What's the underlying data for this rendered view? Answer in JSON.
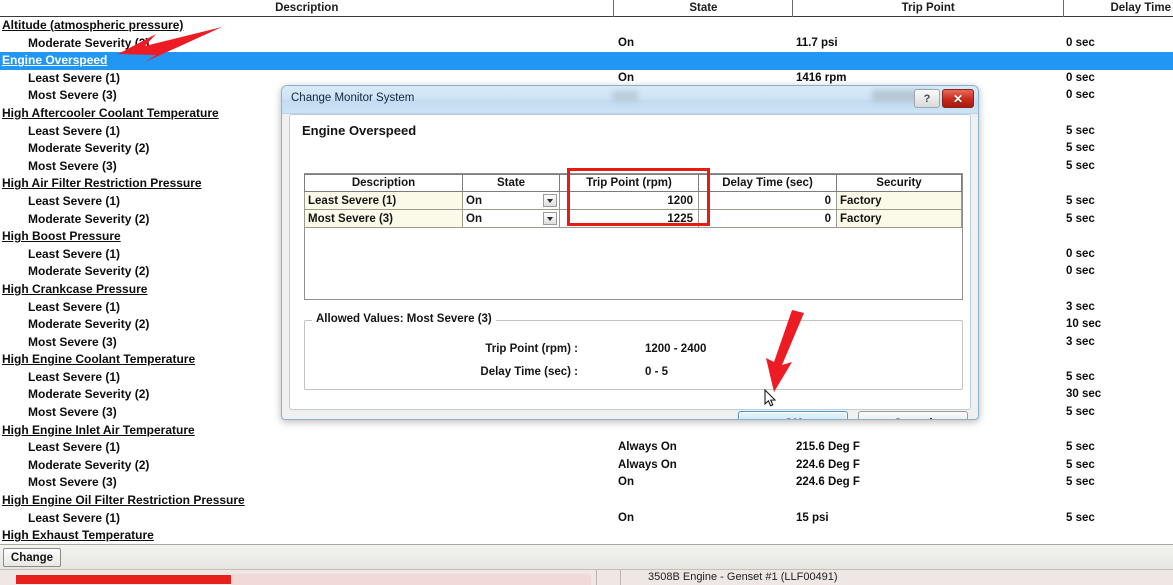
{
  "grid": {
    "columns": [
      "Description",
      "State",
      "Trip Point",
      "Delay Time"
    ],
    "rows": [
      {
        "type": "group",
        "description": "Altitude (atmospheric pressure)",
        "state": "",
        "trip_point": "",
        "delay_time": ""
      },
      {
        "type": "child",
        "description": "Moderate Severity (2)",
        "state": "On",
        "trip_point": "11.7 psi",
        "delay_time": "0 sec"
      },
      {
        "type": "group",
        "description": "Engine Overspeed",
        "state": "",
        "trip_point": "",
        "delay_time": "",
        "selected": true
      },
      {
        "type": "child",
        "description": "Least Severe (1)",
        "state": "On",
        "trip_point": "1416 rpm",
        "delay_time": "0 sec"
      },
      {
        "type": "child",
        "description": "Most Severe (3)",
        "state": "",
        "trip_point": "",
        "delay_time": "0 sec"
      },
      {
        "type": "group",
        "description": "High Aftercooler Coolant Temperature",
        "state": "",
        "trip_point": "",
        "delay_time": ""
      },
      {
        "type": "child",
        "description": "Least Severe (1)",
        "state": "",
        "trip_point": "",
        "delay_time": "5 sec"
      },
      {
        "type": "child",
        "description": "Moderate Severity (2)",
        "state": "",
        "trip_point": "",
        "delay_time": "5 sec"
      },
      {
        "type": "child",
        "description": "Most Severe (3)",
        "state": "",
        "trip_point": "",
        "delay_time": "5 sec"
      },
      {
        "type": "group",
        "description": "High Air Filter Restriction Pressure",
        "state": "",
        "trip_point": "",
        "delay_time": ""
      },
      {
        "type": "child",
        "description": "Least Severe (1)",
        "state": "",
        "trip_point": "",
        "delay_time": "5 sec"
      },
      {
        "type": "child",
        "description": "Moderate Severity (2)",
        "state": "",
        "trip_point": "",
        "delay_time": "5 sec"
      },
      {
        "type": "group",
        "description": "High Boost Pressure",
        "state": "",
        "trip_point": "",
        "delay_time": ""
      },
      {
        "type": "child",
        "description": "Least Severe (1)",
        "state": "",
        "trip_point": "",
        "delay_time": "0 sec"
      },
      {
        "type": "child",
        "description": "Moderate Severity (2)",
        "state": "",
        "trip_point": "",
        "delay_time": "0 sec"
      },
      {
        "type": "group",
        "description": "High Crankcase Pressure",
        "state": "",
        "trip_point": "",
        "delay_time": ""
      },
      {
        "type": "child",
        "description": "Least Severe (1)",
        "state": "",
        "trip_point": "",
        "delay_time": "3 sec"
      },
      {
        "type": "child",
        "description": "Moderate Severity (2)",
        "state": "",
        "trip_point": "",
        "delay_time": "10 sec"
      },
      {
        "type": "child",
        "description": "Most Severe (3)",
        "state": "",
        "trip_point": "",
        "delay_time": "3 sec"
      },
      {
        "type": "group",
        "description": "High Engine Coolant Temperature",
        "state": "",
        "trip_point": "",
        "delay_time": ""
      },
      {
        "type": "child",
        "description": "Least Severe (1)",
        "state": "",
        "trip_point": "",
        "delay_time": "5 sec"
      },
      {
        "type": "child",
        "description": "Moderate Severity (2)",
        "state": "",
        "trip_point": "",
        "delay_time": "30 sec"
      },
      {
        "type": "child",
        "description": "Most Severe (3)",
        "state": "",
        "trip_point": "",
        "delay_time": "5 sec"
      },
      {
        "type": "group",
        "description": "High Engine Inlet Air Temperature",
        "state": "",
        "trip_point": "",
        "delay_time": ""
      },
      {
        "type": "child",
        "description": "Least Severe (1)",
        "state": "Always On",
        "trip_point": "215.6 Deg F",
        "delay_time": "5 sec"
      },
      {
        "type": "child",
        "description": "Moderate Severity (2)",
        "state": "Always On",
        "trip_point": "224.6 Deg F",
        "delay_time": "5 sec"
      },
      {
        "type": "child",
        "description": "Most Severe (3)",
        "state": "On",
        "trip_point": "224.6 Deg F",
        "delay_time": "5 sec"
      },
      {
        "type": "group",
        "description": "High Engine Oil Filter Restriction Pressure",
        "state": "",
        "trip_point": "",
        "delay_time": ""
      },
      {
        "type": "child",
        "description": "Least Severe (1)",
        "state": "On",
        "trip_point": "15 psi",
        "delay_time": "5 sec"
      },
      {
        "type": "group",
        "description": "High Exhaust Temperature",
        "state": "",
        "trip_point": "",
        "delay_time": ""
      }
    ]
  },
  "toolbar": {
    "change_label": "Change"
  },
  "statusbar": {
    "engine_text": "3508B Engine - Genset #1 (LLF00491)"
  },
  "dialog": {
    "title": "Change Monitor System",
    "heading": "Engine Overspeed",
    "help_glyph": "?",
    "close_glyph": "✕",
    "table": {
      "columns": [
        "Description",
        "State",
        "Trip Point (rpm)",
        "Delay Time (sec)",
        "Security"
      ],
      "rows": [
        {
          "description": "Least Severe (1)",
          "state": "On",
          "trip_point": "1200",
          "delay_time": "0",
          "security": "Factory"
        },
        {
          "description": "Most Severe (3)",
          "state": "On",
          "trip_point": "1225",
          "delay_time": "0",
          "security": "Factory"
        }
      ]
    },
    "allowed_values": {
      "legend": "Allowed Values: Most Severe (3)",
      "trip_point_label": "Trip Point (rpm) :",
      "trip_point_value": "1200 - 2400",
      "delay_time_label": "Delay Time (sec) :",
      "delay_time_value": "0 - 5"
    },
    "buttons": {
      "ok": "OK",
      "cancel": "Cancel"
    }
  },
  "annotations": {
    "highlight_color": "#e61b14",
    "arrow_color": "#ed1c24",
    "selection_color": "#2196f3"
  }
}
